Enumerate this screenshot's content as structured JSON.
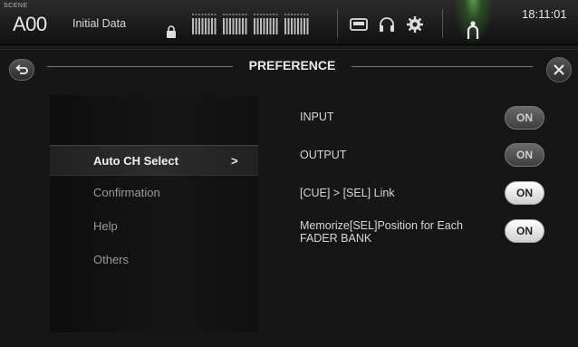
{
  "topbar": {
    "scene_caption": "SCENE",
    "scene_number": "A00",
    "scene_name": "Initial Data",
    "clock": "18:11:01"
  },
  "window": {
    "title": "PREFERENCE"
  },
  "menu": {
    "items": [
      {
        "label": "Auto CH Select",
        "active": true,
        "arrow": ">"
      },
      {
        "label": "Confirmation",
        "active": false
      },
      {
        "label": "Help",
        "active": false
      },
      {
        "label": "Others",
        "active": false
      }
    ]
  },
  "settings": [
    {
      "label": "INPUT",
      "state": "ON",
      "enabled": false
    },
    {
      "label": "OUTPUT",
      "state": "ON",
      "enabled": false
    },
    {
      "label": "[CUE] > [SEL] Link",
      "state": "ON",
      "enabled": true
    },
    {
      "label": "Memorize[SEL]Position for Each FADER BANK",
      "state": "ON",
      "enabled": true
    }
  ],
  "colors": {
    "background": "#161616",
    "accent_green": "#5a9a4a",
    "toggle_on": "#ffffff",
    "toggle_off": "#555555"
  },
  "icons": [
    "lock-icon",
    "meter-icon",
    "memory-card-icon",
    "headphones-icon",
    "gear-icon",
    "user-icon",
    "back-icon",
    "close-icon"
  ]
}
